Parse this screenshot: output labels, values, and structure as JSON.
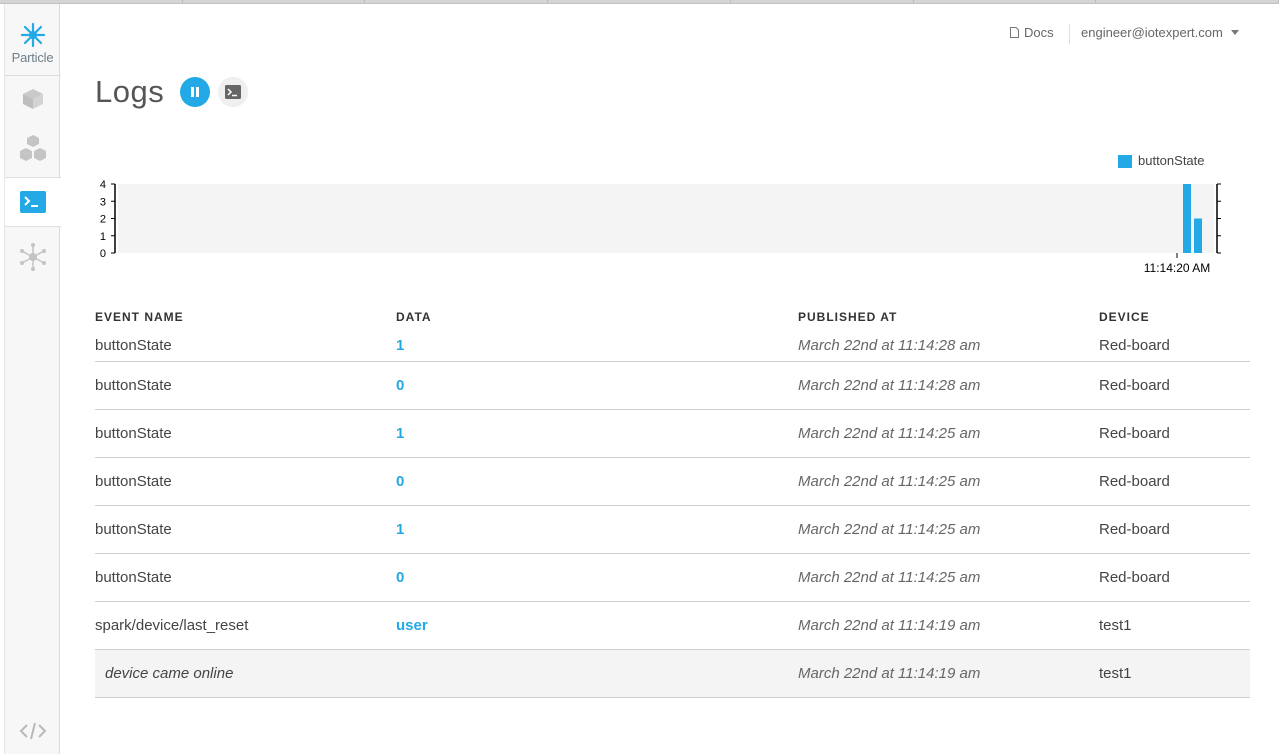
{
  "sidebar": {
    "brand": "Particle",
    "items": [
      {
        "name": "devices",
        "icon": "cube-icon"
      },
      {
        "name": "products",
        "icon": "cubes-icon"
      },
      {
        "name": "logs",
        "icon": "terminal-icon",
        "active": true
      },
      {
        "name": "integrations",
        "icon": "network-icon"
      },
      {
        "name": "build",
        "icon": "code-icon"
      }
    ]
  },
  "header": {
    "docs_label": "Docs",
    "account_email": "engineer@iotexpert.com"
  },
  "page": {
    "title": "Logs"
  },
  "chart_data": {
    "type": "bar",
    "legend": "buttonState",
    "legend_position": "top-right",
    "y_ticks": [
      "0",
      "1",
      "2",
      "3",
      "4"
    ],
    "ylim": [
      0,
      4
    ],
    "x_label": "11:14:20 AM",
    "values": [
      4,
      2
    ],
    "color": "#22a9e6"
  },
  "table": {
    "headers": [
      "EVENT NAME",
      "DATA",
      "PUBLISHED AT",
      "DEVICE"
    ],
    "rows": [
      {
        "event": "buttonState",
        "data": "1",
        "published": "March 22nd at 11:14:28 am",
        "device": "Red-board"
      },
      {
        "event": "buttonState",
        "data": "0",
        "published": "March 22nd at 11:14:28 am",
        "device": "Red-board"
      },
      {
        "event": "buttonState",
        "data": "1",
        "published": "March 22nd at 11:14:25 am",
        "device": "Red-board"
      },
      {
        "event": "buttonState",
        "data": "0",
        "published": "March 22nd at 11:14:25 am",
        "device": "Red-board"
      },
      {
        "event": "buttonState",
        "data": "1",
        "published": "March 22nd at 11:14:25 am",
        "device": "Red-board"
      },
      {
        "event": "buttonState",
        "data": "0",
        "published": "March 22nd at 11:14:25 am",
        "device": "Red-board"
      },
      {
        "event": "spark/device/last_reset",
        "data": "user",
        "published": "March 22nd at 11:14:19 am",
        "device": "test1"
      },
      {
        "event": "device came online",
        "data": "",
        "published": "March 22nd at 11:14:19 am",
        "device": "test1"
      }
    ]
  }
}
